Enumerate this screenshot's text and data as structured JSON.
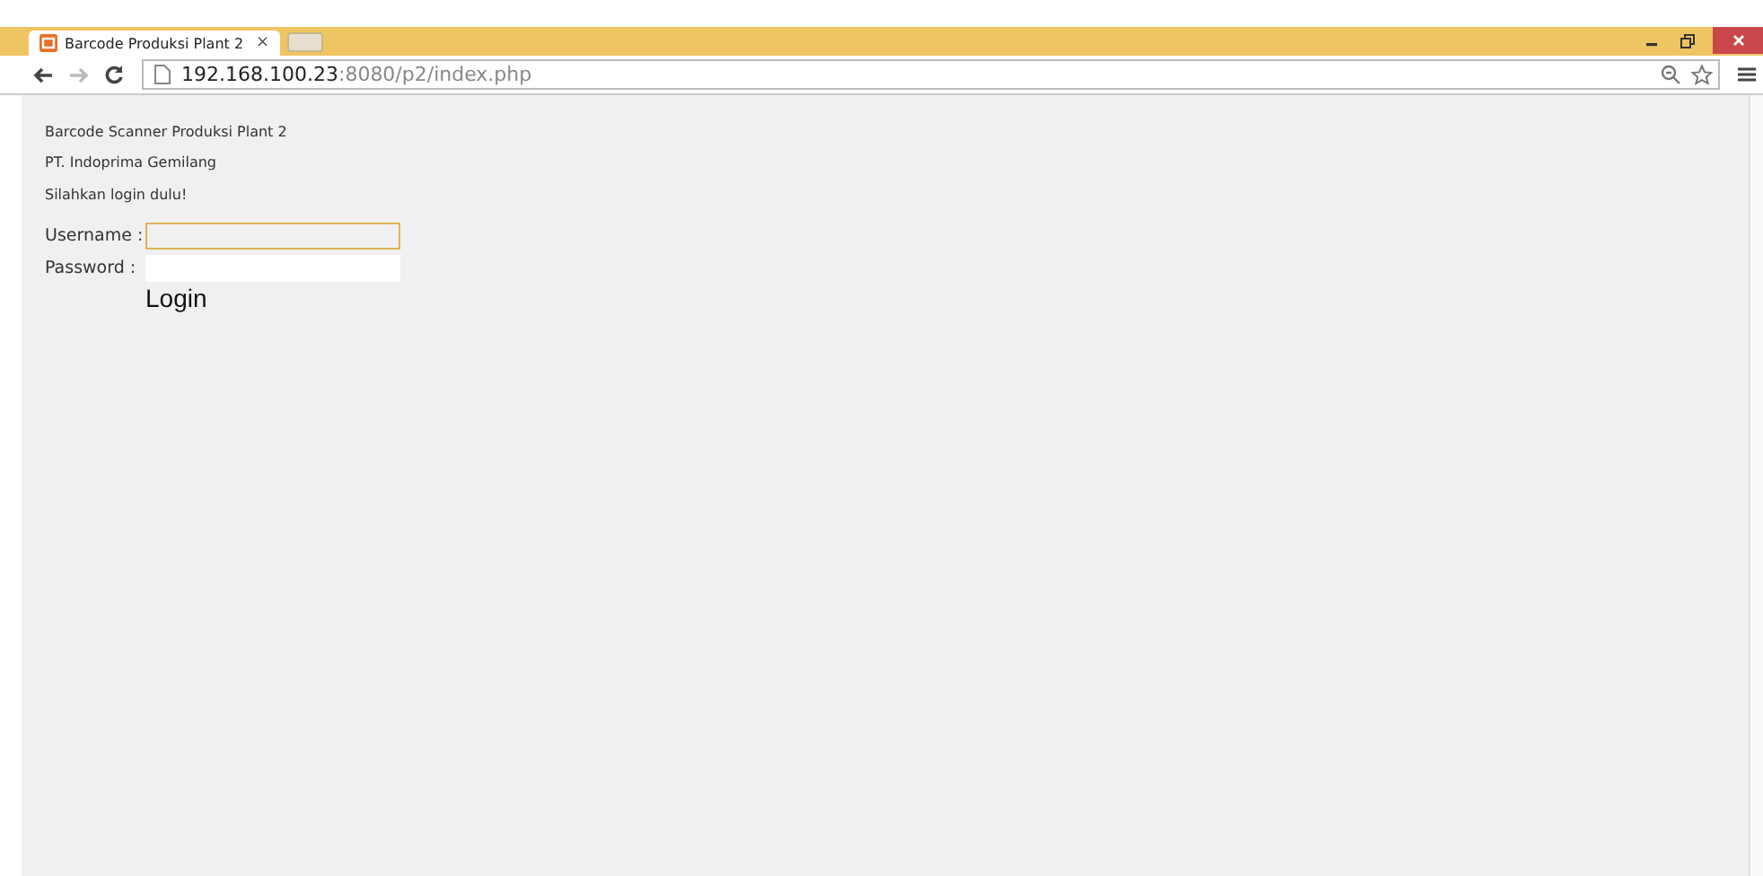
{
  "window": {
    "tab_title": "Barcode Produksi Plant 2",
    "tab_close": "×"
  },
  "address_bar": {
    "host": "192.168.100.23",
    "path": ":8080/p2/index.php"
  },
  "page": {
    "heading": "Barcode Scanner Produksi Plant 2",
    "company": "PT. Indoprima Gemilang",
    "prompt": "Silahkan login dulu!",
    "fields": [
      {
        "label": "Username :",
        "focused": true
      },
      {
        "label": "Password :",
        "focused": false
      }
    ],
    "login_button": "Login"
  }
}
